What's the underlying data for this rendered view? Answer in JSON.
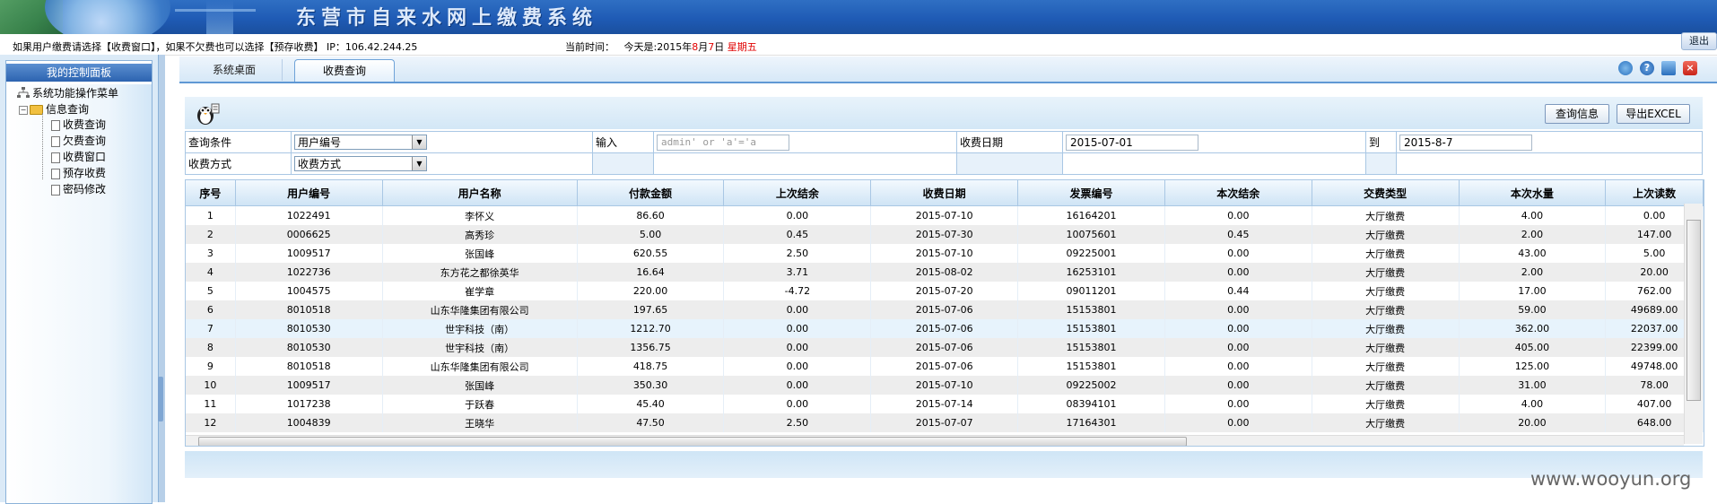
{
  "header": {
    "title": "东营市自来水网上缴费系统"
  },
  "infobar": {
    "notice": "如果用户缴费请选择【收费窗口】，如果不欠费也可以选择【预存收费】 IP：106.42.244.25",
    "time_label": "当前时间：",
    "today_label": "今天是:2015年",
    "month": "8",
    "month_suffix": "月",
    "day": "7",
    "day_suffix": "日",
    "weekday": "星期五",
    "logout": "退出"
  },
  "sidebar": {
    "title": "我的控制面板",
    "root": "系统功能操作菜单",
    "folder": "信息查询",
    "items": [
      {
        "label": "收费查询"
      },
      {
        "label": "欠费查询"
      },
      {
        "label": "收费窗口"
      },
      {
        "label": "预存收费"
      },
      {
        "label": "密码修改"
      }
    ]
  },
  "tabs": [
    {
      "label": "系统桌面"
    },
    {
      "label": "收费查询"
    }
  ],
  "toolbar": {
    "query_button": "查询信息",
    "export_button": "导出EXCEL"
  },
  "filter": {
    "condition_label": "查询条件",
    "condition_value": "用户编号",
    "input_label": "输入",
    "input_placeholder": "admin' or 'a'='a",
    "date_label": "收费日期",
    "date_from": "2015-07-01",
    "to_label": "到",
    "date_to": "2015-8-7",
    "method_label": "收费方式",
    "method_value": "收费方式"
  },
  "grid": {
    "columns": [
      "序号",
      "用户编号",
      "用户名称",
      "付款金额",
      "上次结余",
      "收费日期",
      "发票编号",
      "本次结余",
      "交费类型",
      "本次水量",
      "上次读数"
    ],
    "rows": [
      [
        "1",
        "1022491",
        "李怀义",
        "86.60",
        "0.00",
        "2015-07-10",
        "16164201",
        "0.00",
        "大厅缴费",
        "4.00",
        "0.00"
      ],
      [
        "2",
        "0006625",
        "高秀珍",
        "5.00",
        "0.45",
        "2015-07-30",
        "10075601",
        "0.45",
        "大厅缴费",
        "2.00",
        "147.00"
      ],
      [
        "3",
        "1009517",
        "张国峰",
        "620.55",
        "2.50",
        "2015-07-10",
        "09225001",
        "0.00",
        "大厅缴费",
        "43.00",
        "5.00"
      ],
      [
        "4",
        "1022736",
        "东方花之都徐英华",
        "16.64",
        "3.71",
        "2015-08-02",
        "16253101",
        "0.00",
        "大厅缴费",
        "2.00",
        "20.00"
      ],
      [
        "5",
        "1004575",
        "崔学章",
        "220.00",
        "-4.72",
        "2015-07-20",
        "09011201",
        "0.44",
        "大厅缴费",
        "17.00",
        "762.00"
      ],
      [
        "6",
        "8010518",
        "山东华隆集团有限公司",
        "197.65",
        "0.00",
        "2015-07-06",
        "15153801",
        "0.00",
        "大厅缴费",
        "59.00",
        "49689.00"
      ],
      [
        "7",
        "8010530",
        "世宇科技（南）",
        "1212.70",
        "0.00",
        "2015-07-06",
        "15153801",
        "0.00",
        "大厅缴费",
        "362.00",
        "22037.00"
      ],
      [
        "8",
        "8010530",
        "世宇科技（南）",
        "1356.75",
        "0.00",
        "2015-07-06",
        "15153801",
        "0.00",
        "大厅缴费",
        "405.00",
        "22399.00"
      ],
      [
        "9",
        "8010518",
        "山东华隆集团有限公司",
        "418.75",
        "0.00",
        "2015-07-06",
        "15153801",
        "0.00",
        "大厅缴费",
        "125.00",
        "49748.00"
      ],
      [
        "10",
        "1009517",
        "张国峰",
        "350.30",
        "0.00",
        "2015-07-10",
        "09225002",
        "0.00",
        "大厅缴费",
        "31.00",
        "78.00"
      ],
      [
        "11",
        "1017238",
        "于跃春",
        "45.40",
        "0.00",
        "2015-07-14",
        "08394101",
        "0.00",
        "大厅缴费",
        "4.00",
        "407.00"
      ],
      [
        "12",
        "1004839",
        "王晓华",
        "47.50",
        "2.50",
        "2015-07-07",
        "17164301",
        "0.00",
        "大厅缴费",
        "20.00",
        "648.00"
      ]
    ]
  },
  "watermark": "www.wooyun.org"
}
